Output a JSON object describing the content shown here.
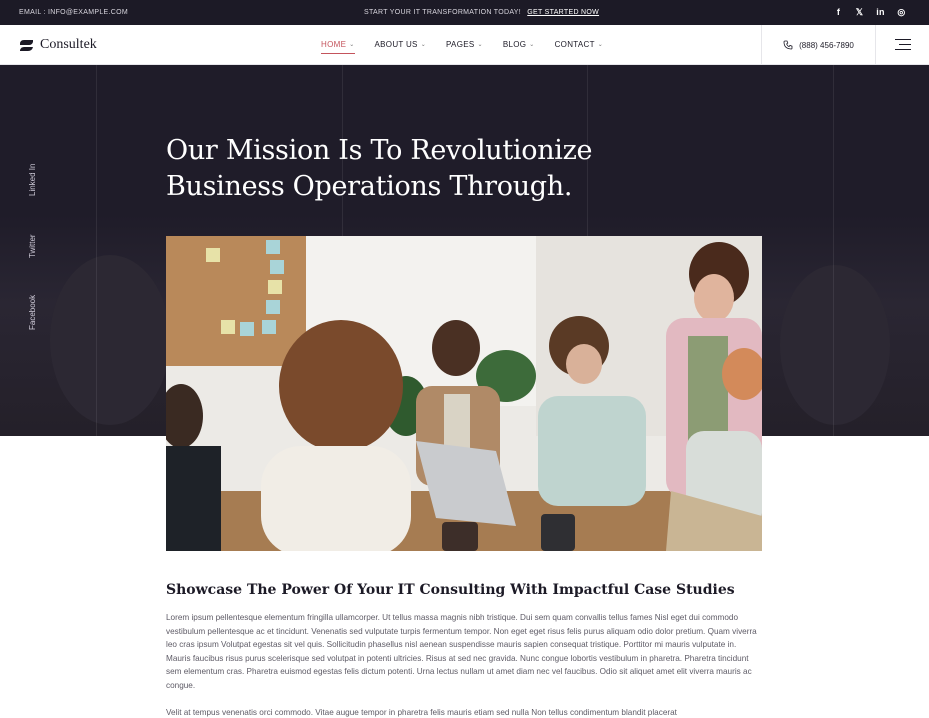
{
  "topbar": {
    "email": "EMAIL : INFO@EXAMPLE.COM",
    "promo_text": "START YOUR IT TRANSFORMATION TODAY!",
    "promo_link": "GET STARTED NOW",
    "social": [
      "f",
      "𝕏",
      "in",
      "◎"
    ]
  },
  "header": {
    "logo_text": "Consultek",
    "nav": [
      {
        "label": "HOME",
        "active": true
      },
      {
        "label": "ABOUT US",
        "active": false
      },
      {
        "label": "PAGES",
        "active": false
      },
      {
        "label": "BLOG",
        "active": false
      },
      {
        "label": "CONTACT",
        "active": false
      }
    ],
    "phone": "(888) 456-7890"
  },
  "hero": {
    "title_line1": "Our Mission Is To Revolutionize",
    "title_line2": "Business Operations Through.",
    "side_social": [
      "Linked In",
      "Twitter",
      "Facebook"
    ]
  },
  "content": {
    "section_title": "Showcase The Power Of Your IT Consulting With Impactful Case Studies",
    "paragraph1": "Lorem ipsum pellentesque elementum fringilla ullamcorper. Ut tellus massa magnis nibh tristique. Dui sem quam convallis tellus fames Nisl eget dui commodo vestibulum pellentesque ac et tincidunt. Venenatis sed vulputate turpis fermentum tempor. Non eget eget risus felis purus aliquam odio dolor pretium. Quam viverra leo cras ipsum Volutpat egestas sit vel quis. Sollicitudin phasellus nisl aenean suspendisse mauris sapien consequat tristique. Porttitor mi mauris vulputate in. Mauris faucibus risus purus scelerisque sed volutpat in potenti ultricies. Risus at sed nec gravida. Nunc congue lobortis vestibulum in pharetra. Pharetra tincidunt sem elementum cras. Pharetra euismod egestas felis dictum potenti. Urna lectus nullam ut amet diam nec vel faucibus. Odio sit aliquet amet elit viverra mauris ac congue.",
    "paragraph2": "Velit at tempus venenatis orci commodo. Vitae augue tempor in pharetra felis mauris etiam sed nulla Non tellus condimentum blandit placerat"
  },
  "colors": {
    "dark": "#1c1a26",
    "accent": "#c4545c"
  }
}
